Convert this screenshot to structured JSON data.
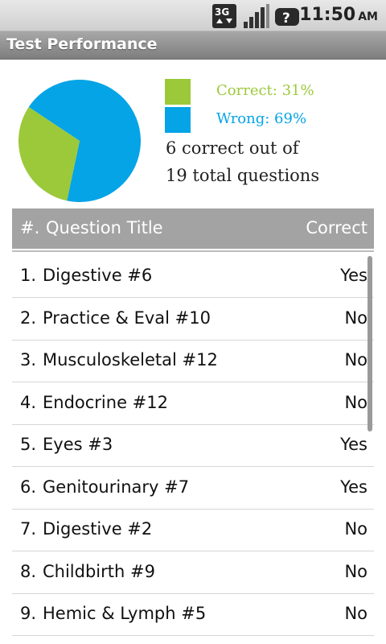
{
  "status_bar": {
    "time": "11:50",
    "ampm": "AM",
    "network_label": "3G",
    "icons": [
      "network-3g-icon",
      "signal-icon",
      "battery-unknown-icon"
    ]
  },
  "app": {
    "title": "Test Performance"
  },
  "chart_data": {
    "type": "pie",
    "slices": [
      {
        "label": "Correct",
        "value": 31,
        "color": "#9cc93a"
      },
      {
        "label": "Wrong",
        "value": 69,
        "color": "#05a4e6"
      }
    ]
  },
  "legend": {
    "correct_label": "Correct: 31%",
    "wrong_label": "Wrong: 69%"
  },
  "summary": {
    "line1": "6 correct out of",
    "line2": "19 total questions"
  },
  "table": {
    "headers": {
      "num": "#.",
      "title": "Question Title",
      "correct": "Correct"
    },
    "rows": [
      {
        "num": "1.",
        "title": "Digestive #6",
        "correct": "Yes"
      },
      {
        "num": "2.",
        "title": "Practice & Eval #10",
        "correct": "No"
      },
      {
        "num": "3.",
        "title": "Musculoskeletal #12",
        "correct": "No"
      },
      {
        "num": "4.",
        "title": "Endocrine #12",
        "correct": "No"
      },
      {
        "num": "5.",
        "title": "Eyes #3",
        "correct": "Yes"
      },
      {
        "num": "6.",
        "title": "Genitourinary #7",
        "correct": "Yes"
      },
      {
        "num": "7.",
        "title": "Digestive #2",
        "correct": "No"
      },
      {
        "num": "8.",
        "title": "Childbirth #9",
        "correct": "No"
      },
      {
        "num": "9.",
        "title": "Hemic & Lymph #5",
        "correct": "No"
      }
    ]
  }
}
